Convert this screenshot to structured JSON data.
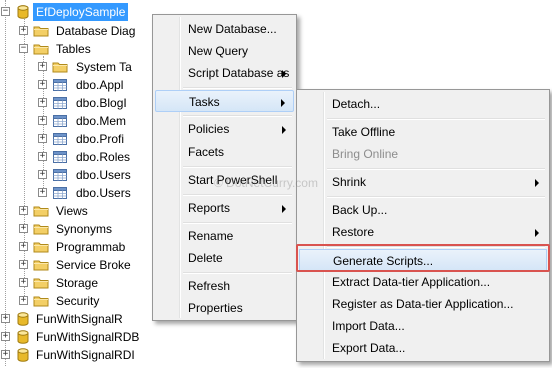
{
  "tree": {
    "db_label": "EfDeploySample",
    "items": [
      {
        "label": "Database Diag"
      },
      {
        "label": "Tables"
      },
      {
        "label": "System Ta"
      },
      {
        "label": "dbo.Appl"
      },
      {
        "label": "dbo.BlogI"
      },
      {
        "label": "dbo.Mem"
      },
      {
        "label": "dbo.Profi"
      },
      {
        "label": "dbo.Roles"
      },
      {
        "label": "dbo.Users"
      },
      {
        "label": "dbo.Users"
      },
      {
        "label": "Views"
      },
      {
        "label": "Synonyms"
      },
      {
        "label": "Programmab"
      },
      {
        "label": "Service Broke"
      },
      {
        "label": "Storage"
      },
      {
        "label": "Security"
      }
    ],
    "other_dbs": [
      {
        "label": "FunWithSignalR"
      },
      {
        "label": "FunWithSignalRDB"
      },
      {
        "label": "FunWithSignalRDI"
      }
    ]
  },
  "context_menu": {
    "items": [
      "New Database...",
      "New Query",
      "Script Database as",
      "Tasks",
      "Policies",
      "Facets",
      "Start PowerShell",
      "Reports",
      "Rename",
      "Delete",
      "Refresh",
      "Properties"
    ]
  },
  "tasks_menu": {
    "items": [
      "Detach...",
      "Take Offline",
      "Bring Online",
      "Shrink",
      "Back Up...",
      "Restore",
      "Generate Scripts...",
      "Extract Data-tier Application...",
      "Register as Data-tier Application...",
      "Import Data...",
      "Export Data..."
    ]
  },
  "watermark": "© DotNetCurry.com",
  "colors": {
    "selection": "#3399ff",
    "highlight_box": "#d9534f",
    "menu_bg": "#f0f0f0"
  }
}
